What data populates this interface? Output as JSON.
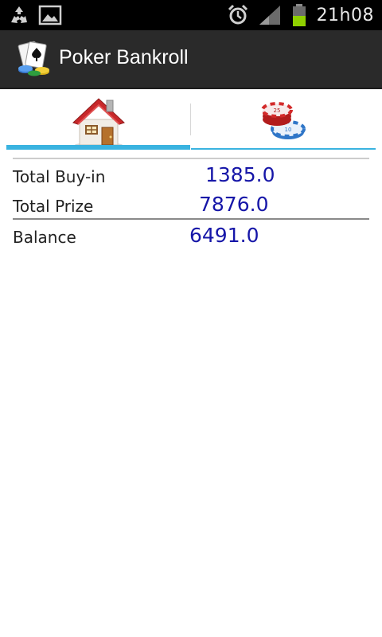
{
  "status_bar": {
    "time": "21h08",
    "icons": [
      "recycle-icon",
      "image-icon",
      "alarm-icon",
      "signal-icon",
      "battery-icon"
    ]
  },
  "app": {
    "title": "Poker Bankroll"
  },
  "tabs": [
    {
      "icon": "house-icon",
      "selected": true
    },
    {
      "icon": "poker-chips-icon",
      "selected": false
    }
  ],
  "stats": {
    "total_buyin": {
      "label": "Total Buy-in",
      "value": "1385.0"
    },
    "total_prize": {
      "label": "Total Prize",
      "value": "7876.0"
    },
    "balance": {
      "label": "Balance",
      "value": "6491.0"
    }
  },
  "colors": {
    "accent": "#3ab3e0",
    "value_text": "#1616a8",
    "action_bar": "#2a2a2a"
  }
}
